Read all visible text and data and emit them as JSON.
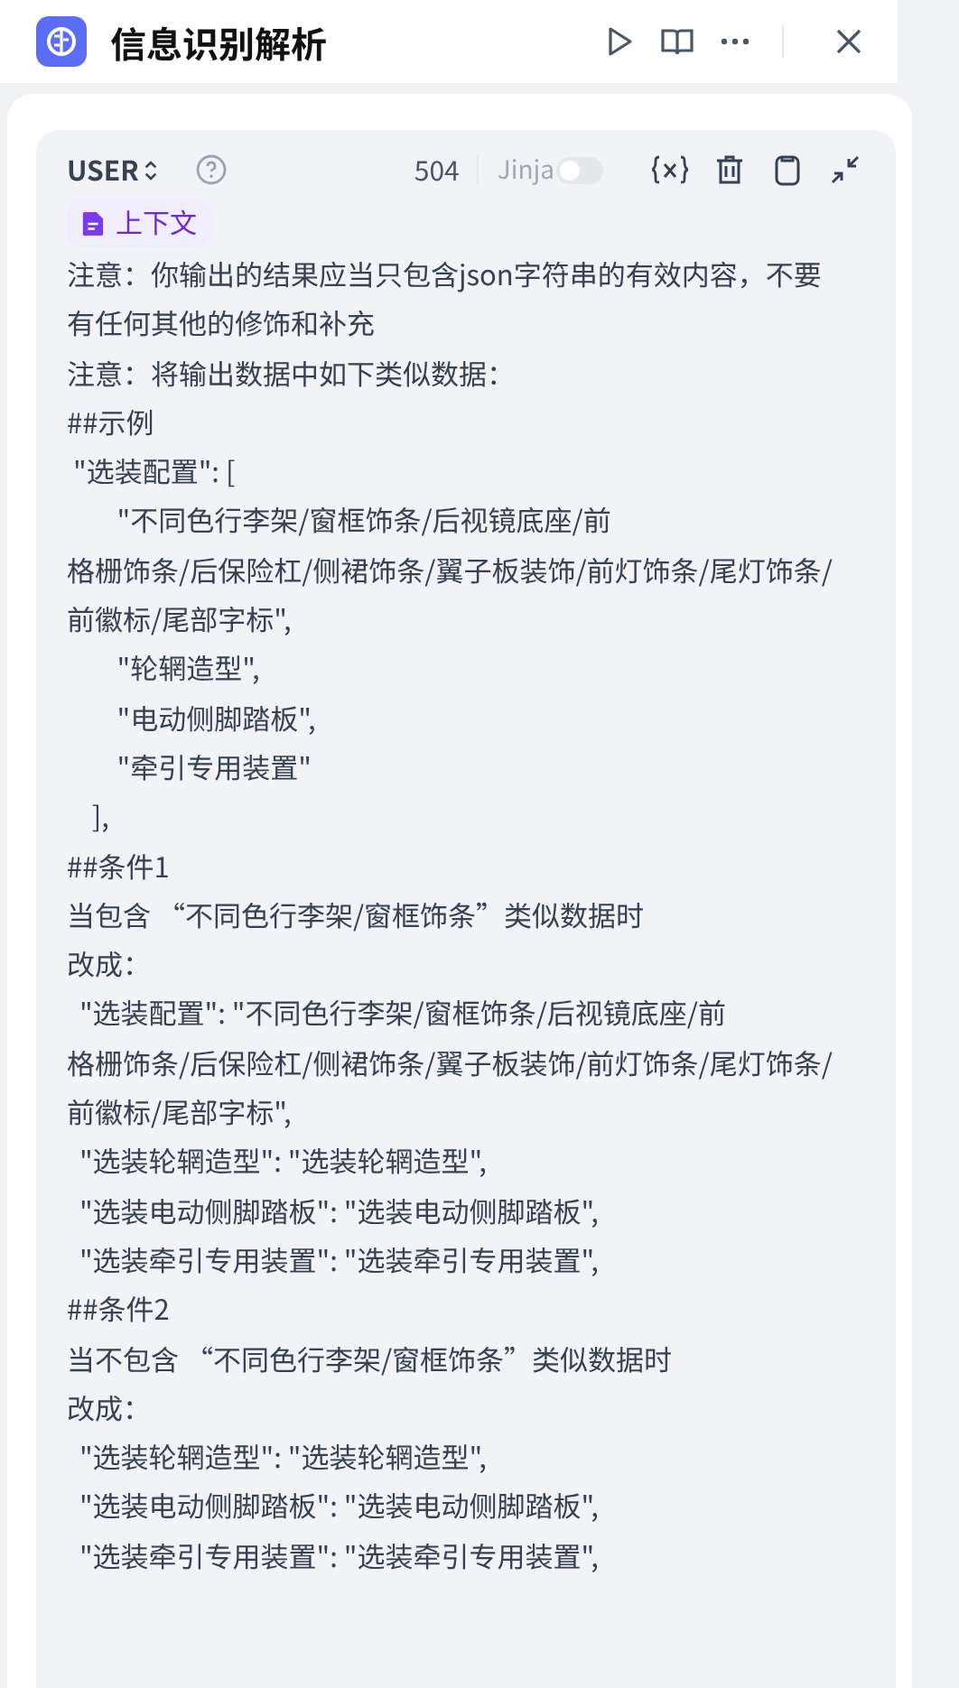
{
  "title": "信息识别解析",
  "role": {
    "label": "USER"
  },
  "count": "504",
  "jinja": {
    "label": "Jinja",
    "on": false,
    "disabled": true
  },
  "context_chip": {
    "label": "上下文"
  },
  "prompt_lines": [
    [
      "注意：你输出的结果应当只包含json字符串的有效内容，不要",
      "有任何其他的修饰和补充"
    ],
    [
      "注意：将输出数据中如下类似数据："
    ],
    [
      "##示例"
    ],
    [
      " \"选装配置\": ["
    ],
    [
      "        \"不同色行李架/窗框饰条/后视镜底座/前",
      "格栅饰条/后保险杠/侧裙饰条/翼子板装饰/前灯饰条/尾灯饰条/",
      "前徽标/尾部字标\","
    ],
    [
      "        \"轮辋造型\","
    ],
    [
      "        \"电动侧脚踏板\","
    ],
    [
      "        \"牵引专用装置\""
    ],
    [
      "    ],"
    ],
    [
      "##条件1"
    ],
    [
      "当包含 “不同色行李架/窗框饰条”类似数据时"
    ],
    [
      "改成："
    ],
    [
      "  \"选装配置\": \"不同色行李架/窗框饰条/后视镜底座/前",
      "格栅饰条/后保险杠/侧裙饰条/翼子板装饰/前灯饰条/尾灯饰条/",
      "前徽标/尾部字标\","
    ],
    [
      "  \"选装轮辋造型\": \"选装轮辋造型\","
    ],
    [
      "  \"选装电动侧脚踏板\": \"选装电动侧脚踏板\","
    ],
    [
      "  \"选装牵引专用装置\": \"选装牵引专用装置\","
    ],
    [
      "##条件2"
    ],
    [
      "当不包含 “不同色行李架/窗框饰条”类似数据时"
    ],
    [
      "改成："
    ],
    [
      "  \"选装轮辋造型\": \"选装轮辋造型\","
    ],
    [
      "  \"选装电动侧脚踏板\": \"选装电动侧脚踏板\","
    ],
    [
      "  \"选装牵引专用装置\": \"选装牵引专用装置\","
    ]
  ]
}
